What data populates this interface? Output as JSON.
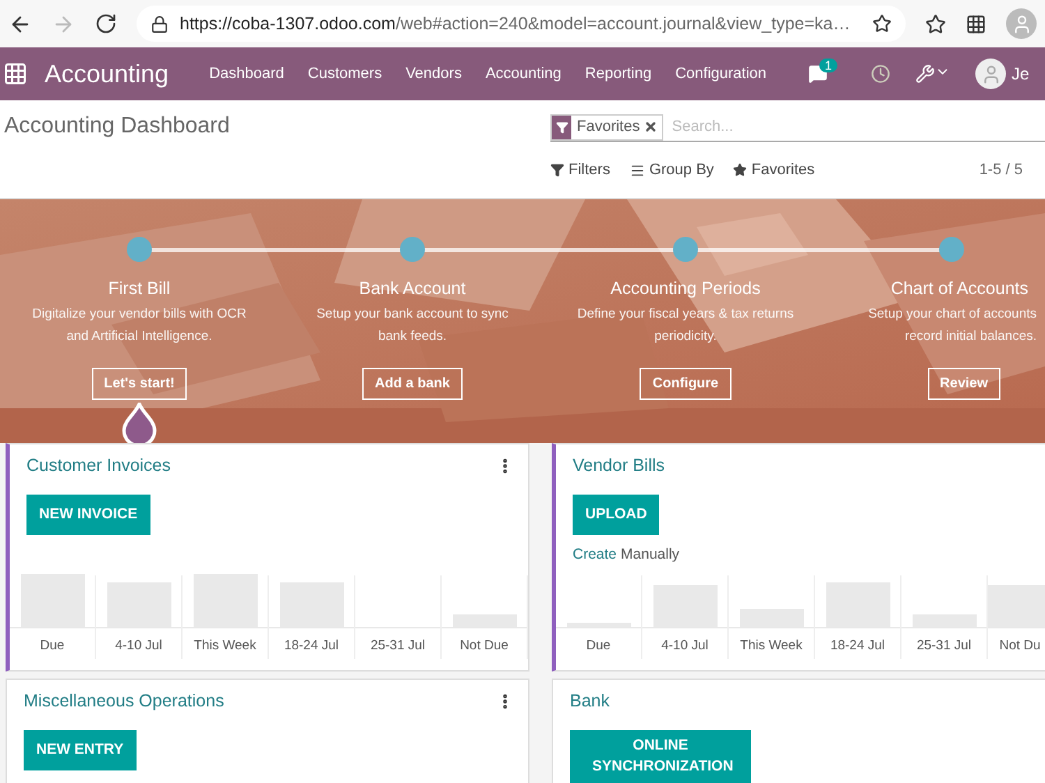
{
  "browser": {
    "url_host": "https://coba-1307.odoo.com",
    "url_rest": "/web#action=240&model=account.journal&view_type=ka…",
    "forward_disabled": true
  },
  "navbar": {
    "brand": "Accounting",
    "menu": [
      "Dashboard",
      "Customers",
      "Vendors",
      "Accounting",
      "Reporting",
      "Configuration"
    ],
    "chat_count": "1",
    "user": "Je"
  },
  "control_panel": {
    "title": "Accounting Dashboard",
    "facet": "Favorites",
    "placeholder": "Search...",
    "buttons": [
      {
        "kind": "filter",
        "label": "Filters"
      },
      {
        "kind": "group",
        "label": "Group By"
      },
      {
        "kind": "star",
        "label": "Favorites"
      }
    ],
    "pager": "1-5 / 5"
  },
  "steps": [
    {
      "title": "First Bill",
      "lines": [
        "Digitalize your vendor bills with OCR",
        "and Artificial Intelligence."
      ],
      "button": "Let's start!",
      "selected": true
    },
    {
      "title": "Bank Account",
      "lines": [
        "Setup your bank account to sync",
        "bank feeds."
      ],
      "button": "Add a bank",
      "selected": false
    },
    {
      "title": "Accounting Periods",
      "lines": [
        "Define your fiscal years & tax returns",
        "periodicity."
      ],
      "button": "Configure",
      "selected": false
    },
    {
      "title": "Chart of Accounts",
      "lines": [
        "Setup your chart of accounts",
        "record initial balances."
      ],
      "button": "Review",
      "selected": false
    }
  ],
  "cards": [
    {
      "title": "Customer Invoices",
      "menu": true,
      "accent": true,
      "button": "NEW INVOICE",
      "categories": [
        "Due",
        "4-10 Jul",
        "This Week",
        "18-24 Jul",
        "25-31 Jul",
        "Not Due"
      ]
    },
    {
      "title": "Vendor Bills",
      "menu": false,
      "accent": true,
      "button": "UPLOAD",
      "link": "Create",
      "link_rest": "Manually",
      "categories": [
        "Due",
        "4-10 Jul",
        "This Week",
        "18-24 Jul",
        "25-31 Jul",
        "Not Du"
      ]
    },
    {
      "title": "Miscellaneous Operations",
      "menu": true,
      "accent": false,
      "button": "NEW ENTRY"
    },
    {
      "title": "Bank",
      "menu": false,
      "accent": false,
      "button": "ONLINE SYNCHRONIZATION"
    }
  ]
}
